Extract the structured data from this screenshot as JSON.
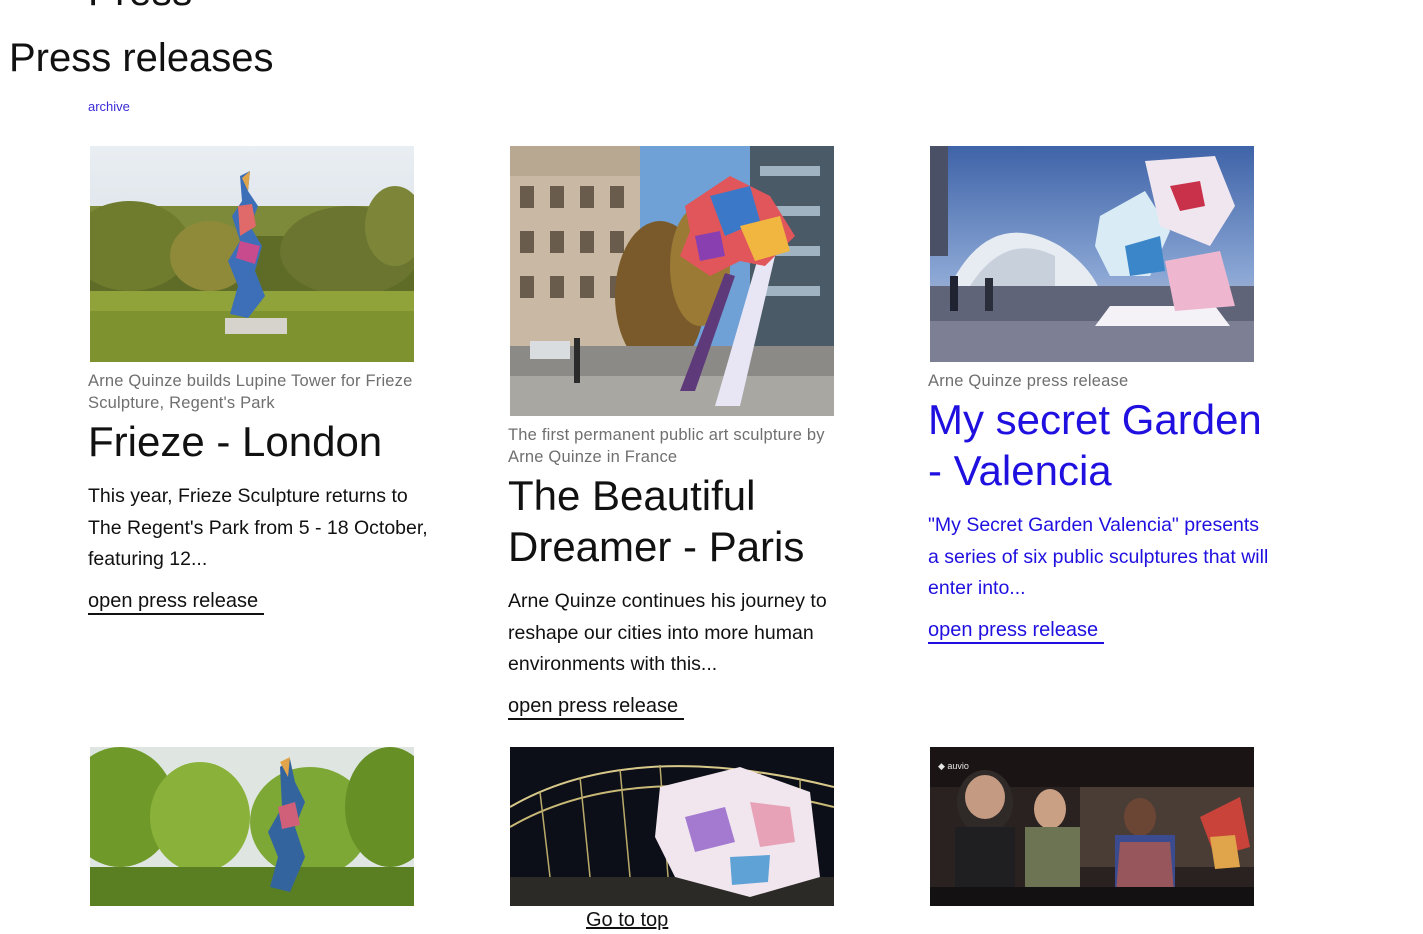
{
  "header": {
    "section_title": "Press",
    "page_title": "Press releases",
    "archive_label": "archive"
  },
  "cards": [
    {
      "kicker": "Arne Quinze builds Lupine Tower for Frieze Sculpture, Regent's Park",
      "headline": "Frieze - London",
      "excerpt": "This year, Frieze Sculpture returns to The Regent's Park from 5 - 18 October, featuring 12...",
      "link_label": "open press release"
    },
    {
      "kicker": "The first permanent public art sculpture by Arne Quinze in France",
      "headline": "The Beautiful Dreamer - Paris",
      "excerpt": "Arne Quinze continues his journey to reshape our cities into more human environments with this...",
      "link_label": "open press release"
    },
    {
      "kicker": "Arne Quinze press release",
      "headline": "My secret Garden - Valencia",
      "excerpt": "\"My Secret Garden Valencia\" presents a series of six public sculptures that will enter into...",
      "link_label": "open press release"
    }
  ],
  "footer": {
    "go_top_label": "Go to top"
  },
  "colors": {
    "link_accent": "#1f10e0",
    "archive_link": "#3a2bd6",
    "kicker_gray": "#6f6f6f"
  }
}
